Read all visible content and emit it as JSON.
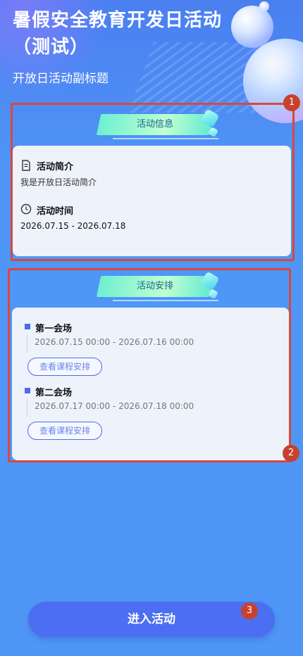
{
  "header": {
    "title": "暑假安全教育开发日活动（测试）",
    "subtitle": "开放日活动副标题"
  },
  "info_section": {
    "badge": "活动信息",
    "intro_label": "活动简介",
    "intro_text": "我是开放日活动简介",
    "time_label": "活动时间",
    "time_text": "2026.07.15 - 2026.07.18"
  },
  "schedule_section": {
    "badge": "活动安排",
    "sessions": [
      {
        "name": "第一会场",
        "time": "2026.07.15 00:00 - 2026.07.16 00:00",
        "button": "查看课程安排"
      },
      {
        "name": "第二会场",
        "time": "2026.07.17 00:00 - 2026.07.18 00:00",
        "button": "查看课程安排"
      }
    ]
  },
  "actions": {
    "enter": "进入活动"
  },
  "annotations": [
    "1",
    "2",
    "3"
  ],
  "icons": {
    "intro": "document-icon",
    "time": "clock-icon"
  },
  "colors": {
    "background": "#4f96f6",
    "accent": "#4a6cf1",
    "annotation": "#d9483b"
  }
}
